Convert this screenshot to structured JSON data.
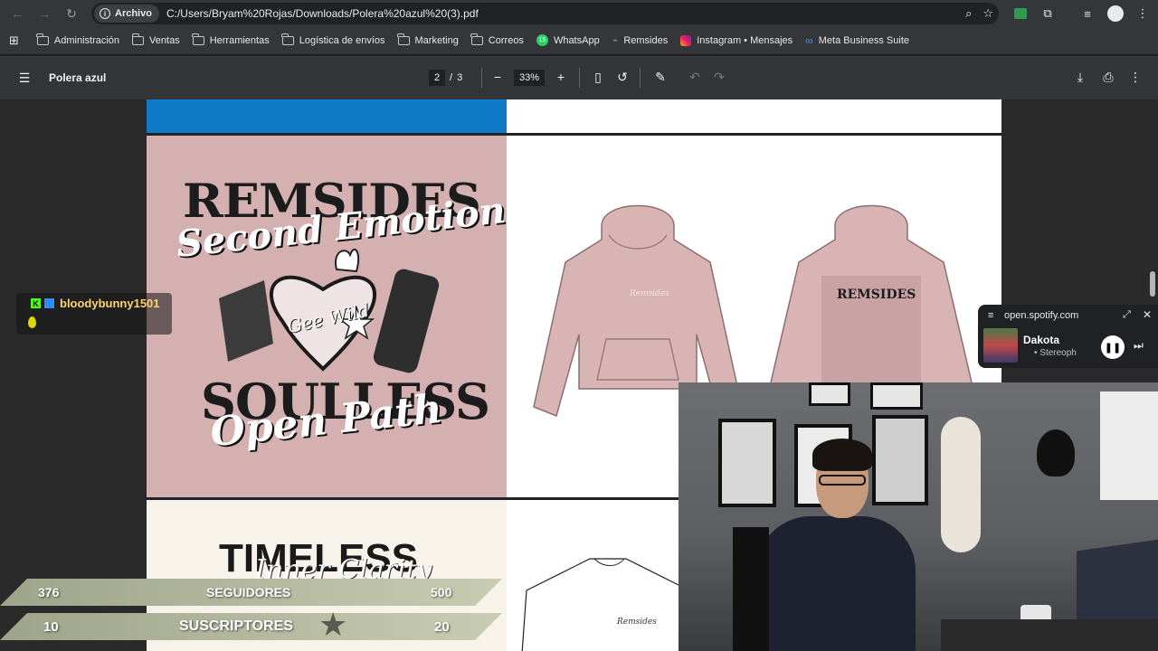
{
  "browser": {
    "address_chip": "Archivo",
    "url": "C:/Users/Bryam%20Rojas/Downloads/Polera%20azul%20(3).pdf",
    "bookmarks": [
      {
        "label": "Administración",
        "icon": "folder-icon"
      },
      {
        "label": "Ventas",
        "icon": "folder-icon"
      },
      {
        "label": "Herramientas",
        "icon": "folder-icon"
      },
      {
        "label": "Logística de envíos",
        "icon": "folder-icon"
      },
      {
        "label": "Marketing",
        "icon": "folder-icon"
      },
      {
        "label": "Correos",
        "icon": "folder-icon"
      },
      {
        "label": "WhatsApp",
        "icon": "whatsapp-icon",
        "badge": "15"
      },
      {
        "label": "Remsides",
        "icon": "remsides-icon"
      },
      {
        "label": "Instagram • Mensajes",
        "icon": "instagram-icon"
      },
      {
        "label": "Meta Business Suite",
        "icon": "meta-icon"
      }
    ]
  },
  "pdf": {
    "title": "Polera azul",
    "current_page": "2",
    "separator": "/",
    "total_pages": "3",
    "zoom": "33%"
  },
  "design": {
    "artwork_top": "REMSIDES",
    "artwork_script_1": "Second Emotion",
    "artwork_heart": "Gee Wild",
    "artwork_bottom": "SOULLESS",
    "artwork_script_2": "Open Path",
    "hoodie_chest": "Remsides",
    "next_title_1": "TIMELESS",
    "next_title_2": "ON",
    "next_script": "Inner Clarity",
    "sweater_chest": "Remsides"
  },
  "stream_overlay": {
    "chat_user": "bloodybunny1501",
    "stats": [
      {
        "current": "376",
        "label": "SEGUIDORES",
        "goal": "500"
      },
      {
        "current": "10",
        "label": "SUSCRIPTORES",
        "goal": "20"
      }
    ]
  },
  "spotify": {
    "domain": "open.spotify.com",
    "track": "Dakota",
    "artist": "• Stereoph"
  },
  "colors": {
    "accent_blue": "#0f7bc8",
    "pink": "#d4b0b1",
    "hoodie_pink": "#d8b4b4",
    "cream": "#f7f3ea"
  }
}
